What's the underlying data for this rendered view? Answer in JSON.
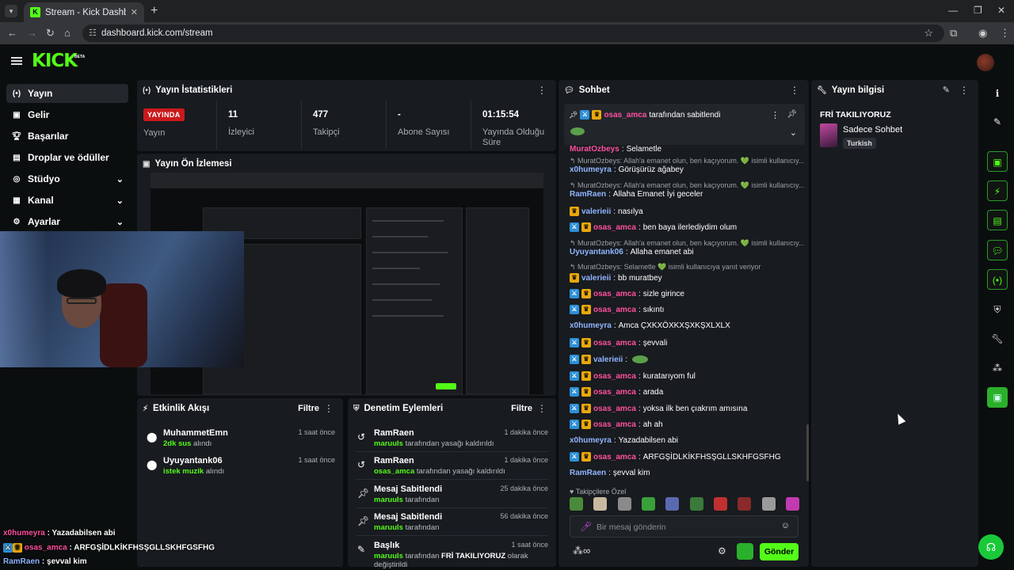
{
  "browser": {
    "tab_title": "Stream - Kick Dashboard",
    "url": "dashboard.kick.com/stream"
  },
  "logo": {
    "text": "KICK",
    "beta": "BETA"
  },
  "sidebar": {
    "items": [
      {
        "label": "Yayın",
        "icon": "broadcast-icon"
      },
      {
        "label": "Gelir",
        "icon": "revenue-icon"
      },
      {
        "label": "Başarılar",
        "icon": "trophy-icon"
      },
      {
        "label": "Droplar ve ödüller",
        "icon": "gift-icon"
      },
      {
        "label": "Stüdyo",
        "icon": "studio-icon"
      },
      {
        "label": "Kanal",
        "icon": "channel-icon"
      },
      {
        "label": "Ayarlar",
        "icon": "settings-icon"
      }
    ]
  },
  "stats": {
    "title": "Yayın İstatistikleri",
    "live_badge": "YAYINDA",
    "live_label": "Yayın",
    "viewers_value": "11",
    "viewers_label": "İzleyici",
    "followers_value": "477",
    "followers_label": "Takipçi",
    "subs_value": "-",
    "subs_label": "Abone Sayısı",
    "duration_value": "01:15:54",
    "duration_label": "Yayında Olduğu Süre"
  },
  "preview": {
    "title": "Yayın Ön İzlemesi"
  },
  "activity": {
    "title": "Etkinlik Akışı",
    "filter": "Filtre",
    "items": [
      {
        "user": "MuhammetEmn",
        "reward": "2dk sus",
        "action": "alındı",
        "time": "1 saat önce"
      },
      {
        "user": "Uyuyantank06",
        "reward": "istek muzik",
        "action": "alındı",
        "time": "1 saat önce"
      }
    ]
  },
  "moderation": {
    "title": "Denetim Eylemleri",
    "filter": "Filtre",
    "items": [
      {
        "title": "RamRaen",
        "actor": "maruuls",
        "rest": "tarafından yasağı kaldırıldı",
        "time": "1 dakika önce"
      },
      {
        "title": "RamRaen",
        "actor": "osas_amca",
        "rest": "tarafından yasağı kaldırıldı",
        "time": "1 dakika önce"
      },
      {
        "title": "Mesaj Sabitlendi",
        "actor": "maruuls",
        "rest": "tarafından",
        "time": "25 dakika önce"
      },
      {
        "title": "Mesaj Sabitlendi",
        "actor": "maruuls",
        "rest": "tarafından",
        "time": "56 dakika önce"
      },
      {
        "title": "Başlık",
        "actor": "maruuls",
        "rest": "tarafından",
        "bold": "FRİ TAKILIYORUZ",
        "rest2": "olarak değiştirildi",
        "time": "1 saat önce"
      }
    ]
  },
  "chat": {
    "title": "Sohbet",
    "pinned_user": "osas_amca",
    "pinned_text": "tarafından sabitlendi",
    "messages": [
      {
        "type": "msg",
        "user": "MuratOzbeys",
        "color": "pink",
        "text": "Selametle"
      },
      {
        "type": "reply",
        "text": "MuratOzbeys: Allah'a emanet olun, ben kaçıyorum. 💚 isimli kullanıcıy..."
      },
      {
        "type": "msg",
        "user": "x0humeyra",
        "color": "blue",
        "text": "Görüşürüz ağabey"
      },
      {
        "type": "reply",
        "text": "MuratOzbeys: Allah'a emanet olun, ben kaçıyorum. 💚 isimli kullanıcıy..."
      },
      {
        "type": "msg",
        "user": "RamRaen",
        "color": "blue",
        "text": "Allaha Emanet İyi geceler"
      },
      {
        "type": "msg",
        "user": "valerieii",
        "color": "blue",
        "crown": true,
        "text": "nasılya"
      },
      {
        "type": "msg",
        "user": "osas_amca",
        "color": "pink",
        "mod": true,
        "crown": true,
        "text": "ben baya ilerlediydim olum"
      },
      {
        "type": "reply",
        "text": "MuratOzbeys: Allah'a emanet olun, ben kaçıyorum. 💚 isimli kullanıcıy..."
      },
      {
        "type": "msg",
        "user": "Uyuyantank06",
        "color": "blue",
        "text": "Allaha emanet abi"
      },
      {
        "type": "reply",
        "text": "MuratOzbeys: Selametle 💚 isimli kullanıcıya yanıt veriyor"
      },
      {
        "type": "msg",
        "user": "valerieii",
        "color": "blue",
        "crown": true,
        "text": "bb muratbey"
      },
      {
        "type": "msg",
        "user": "osas_amca",
        "color": "pink",
        "mod": true,
        "crown": true,
        "text": "sizle girince"
      },
      {
        "type": "msg",
        "user": "osas_amca",
        "color": "pink",
        "mod": true,
        "crown": true,
        "text": "sıkıntı"
      },
      {
        "type": "msg",
        "user": "x0humeyra",
        "color": "blue",
        "text": "Amca ÇXKXÖXKXŞXKŞXLXLX"
      },
      {
        "type": "msg",
        "user": "osas_amca",
        "color": "pink",
        "mod": true,
        "crown": true,
        "text": "şevvali"
      },
      {
        "type": "msg",
        "user": "valerieii",
        "color": "blue",
        "mod": true,
        "crown": true,
        "text": "",
        "emote": true
      },
      {
        "type": "msg",
        "user": "osas_amca",
        "color": "pink",
        "mod": true,
        "crown": true,
        "text": "kuratarıyom ful"
      },
      {
        "type": "msg",
        "user": "osas_amca",
        "color": "pink",
        "mod": true,
        "crown": true,
        "text": "arada"
      },
      {
        "type": "msg",
        "user": "osas_amca",
        "color": "pink",
        "mod": true,
        "crown": true,
        "text": "yoksa ilk ben çıakrım amısına"
      },
      {
        "type": "msg",
        "user": "osas_amca",
        "color": "pink",
        "mod": true,
        "crown": true,
        "text": "ah ah"
      },
      {
        "type": "msg",
        "user": "x0humeyra",
        "color": "blue",
        "text": "Yazadabilsen abi"
      },
      {
        "type": "msg",
        "user": "osas_amca",
        "color": "pink",
        "mod": true,
        "crown": true,
        "text": "ARFGŞİDLKİKFHSŞGLLSKHFGSFHG"
      },
      {
        "type": "msg",
        "user": "RamRaen",
        "color": "blue",
        "text": "şevval kim"
      }
    ],
    "follower_emotes_label": "Takipçilere Özel",
    "input_placeholder": "Bir mesaj gönderin",
    "send_label": "Gönder",
    "emote_colors": [
      "#4a8a3a",
      "#c9b8a0",
      "#8a8a8a",
      "#3aa03a",
      "#5a6ab0",
      "#3a7a3a",
      "#c03030",
      "#8a2a2a",
      "#9a9a9a",
      "#c03ab0"
    ]
  },
  "stream_info": {
    "title": "Yayın bilgisi",
    "stream_title": "FRİ TAKILIYORUZ",
    "category": "Sadece Sohbet",
    "tag": "Turkish"
  },
  "overlay_chat": [
    {
      "user": "x0humeyra",
      "color": "pink",
      "text": "Yazadabilsen abi"
    },
    {
      "user": "osas_amca",
      "color": "pink",
      "text": "ARFGŞİDLKİKFHSŞGLLSKHFGSFHG",
      "badges": true
    },
    {
      "user": "RamRaen",
      "color": "blue",
      "text": "şevval kim"
    }
  ],
  "colors": {
    "accent": "#53fc18",
    "live": "#c9191b",
    "mod_badge": "#2c8fd6",
    "crown_badge": "#e8a80c"
  }
}
